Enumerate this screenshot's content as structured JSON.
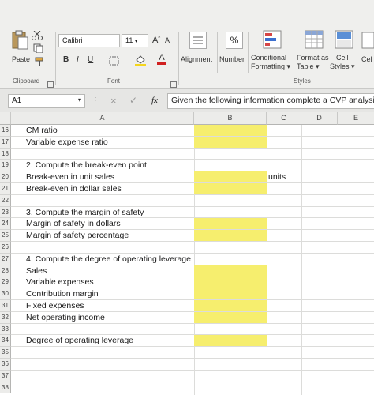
{
  "ribbon": {
    "paste_label": "Paste",
    "clipboard_group": "Clipboard",
    "font_group": "Font",
    "styles_group": "Styles",
    "font_name": "Calibri",
    "font_size": "11",
    "grow_label": "A",
    "shrink_label": "A",
    "bold": "B",
    "italic": "I",
    "underline": "U",
    "font_color_letter": "A",
    "alignment_label": "Alignment",
    "number_label": "Number",
    "number_symbol": "%",
    "conditional_line1": "Conditional",
    "conditional_line2": "Formatting",
    "format_table_line1": "Format as",
    "format_table_line2": "Table",
    "cell_styles_line1": "Cell",
    "cell_styles_line2": "Styles",
    "cells_label": "Cel"
  },
  "formula_bar": {
    "name_box": "A1",
    "fx": "fx",
    "cancel": "×",
    "enter": "✓",
    "content": "Given the following information complete a CVP analysis"
  },
  "columns": [
    "A",
    "B",
    "C",
    "D",
    "E"
  ],
  "rows": [
    {
      "num": "16",
      "a": "CM ratio",
      "c": ""
    },
    {
      "num": "17",
      "a": "Variable expense ratio",
      "c": ""
    },
    {
      "num": "18",
      "a": "",
      "c": ""
    },
    {
      "num": "19",
      "a": "2. Compute the break-even point",
      "c": ""
    },
    {
      "num": "20",
      "a": "Break-even in unit sales",
      "c": "units"
    },
    {
      "num": "21",
      "a": "Break-even in dollar sales",
      "c": ""
    },
    {
      "num": "22",
      "a": "",
      "c": ""
    },
    {
      "num": "23",
      "a": "3. Compute the margin of safety",
      "c": ""
    },
    {
      "num": "24",
      "a": "Margin of safety in dollars",
      "c": ""
    },
    {
      "num": "25",
      "a": "Margin of safety percentage",
      "c": ""
    },
    {
      "num": "26",
      "a": "",
      "c": ""
    },
    {
      "num": "27",
      "a": "4. Compute the degree of operating leverage",
      "c": ""
    },
    {
      "num": "28",
      "a": "Sales",
      "c": ""
    },
    {
      "num": "29",
      "a": "Variable expenses",
      "c": ""
    },
    {
      "num": "30",
      "a": "Contribution margin",
      "c": ""
    },
    {
      "num": "31",
      "a": "Fixed expenses",
      "c": ""
    },
    {
      "num": "32",
      "a": "Net operating income",
      "c": ""
    },
    {
      "num": "33",
      "a": "",
      "c": ""
    },
    {
      "num": "34",
      "a": "Degree of operating leverage",
      "c": ""
    },
    {
      "num": "35",
      "a": "",
      "c": ""
    },
    {
      "num": "36",
      "a": "",
      "c": ""
    },
    {
      "num": "37",
      "a": "",
      "c": ""
    },
    {
      "num": "38",
      "a": "",
      "c": ""
    }
  ],
  "colors": {
    "input_highlight": "#f6ee6e"
  }
}
